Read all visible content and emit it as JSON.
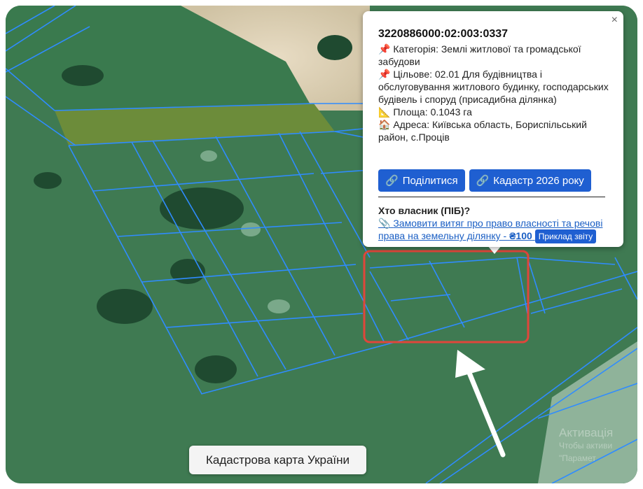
{
  "popup": {
    "parcel_id": "3220886000:02:003:0337",
    "close_label": "×",
    "category_label": "Категорія: Землі житлової та громадської забудови",
    "purpose_label": "Цільове: 02.01 Для будівництва і обслуговування житлового будинку, господарських будівель і споруд (присадибна ділянка)",
    "area_label": "Площа: 0.1043 га",
    "address_label": "Адреса: Київська область, Бориспільський район, с.Проців",
    "share_button": "Поділитися",
    "cadastre_button": "Кадастр 2026 року",
    "owner_title": "Хто власник (ПІБ)?",
    "order_link": "Замовити витяг про право власності та речові права на земельну ділянку - ",
    "order_price": "₴100",
    "sample_button": "Приклад звіту"
  },
  "bottom_label": "Кадастрова карта України",
  "watermark": {
    "line1": "Активація",
    "line2": "Чтобы активи",
    "line3": "\"Парамет"
  },
  "icons": {
    "category": "pushpin-icon",
    "purpose": "pushpin-icon",
    "area": "ruler-icon",
    "address": "house-icon",
    "share": "link-icon",
    "cadastre": "link-icon",
    "order": "paperclip-icon"
  },
  "colors": {
    "parcel_lines": "#2f8cff",
    "highlight": "#e0463b",
    "button": "#1f5fd1",
    "arrow": "#ffffff"
  }
}
